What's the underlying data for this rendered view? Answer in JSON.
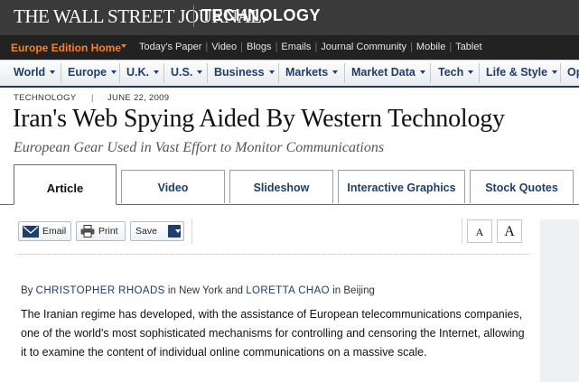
{
  "masthead": {
    "brand": "THE WALL STREET JOURNAL.",
    "section": "TECHNOLOGY"
  },
  "utility": {
    "edition": "Europe Edition Home",
    "links": [
      "Today's Paper",
      "Video",
      "Blogs",
      "Emails",
      "Journal Community",
      "Mobile",
      "Tablet"
    ]
  },
  "nav": {
    "items": [
      "World",
      "Europe",
      "U.K.",
      "U.S.",
      "Business",
      "Markets",
      "Market Data",
      "Tech",
      "Life & Style",
      "Op"
    ]
  },
  "article": {
    "kicker": "TECHNOLOGY",
    "date": "JUNE 22, 2009",
    "headline": "Iran's Web Spying Aided By Western Technology",
    "dek": "European Gear Used in Vast Effort to Monitor Communications",
    "byline": {
      "by": "By",
      "author1": "CHRISTOPHER RHOADS",
      "loc1": "in New York and",
      "author2": "LORETTA CHAO",
      "loc2": "in Beijing"
    },
    "body": "The Iranian regime has developed, with the assistance of European telecommunications companies, one of the world's most sophisticated mechanisms for controlling and censoring the Internet, allowing it to examine the content of individual online communications on a massive scale."
  },
  "tabs": [
    "Article",
    "Video",
    "Slideshow",
    "Interactive Graphics",
    "Stock Quotes"
  ],
  "tools": {
    "email": "Email",
    "print": "Print",
    "save": "Save",
    "font_small": "A",
    "font_large": "A"
  },
  "colors": {
    "accent_orange": "#ff7f1f",
    "nav_blue": "#1f3d6e",
    "masthead_bg": "#3a3a3a",
    "utility_bg": "#222222"
  }
}
